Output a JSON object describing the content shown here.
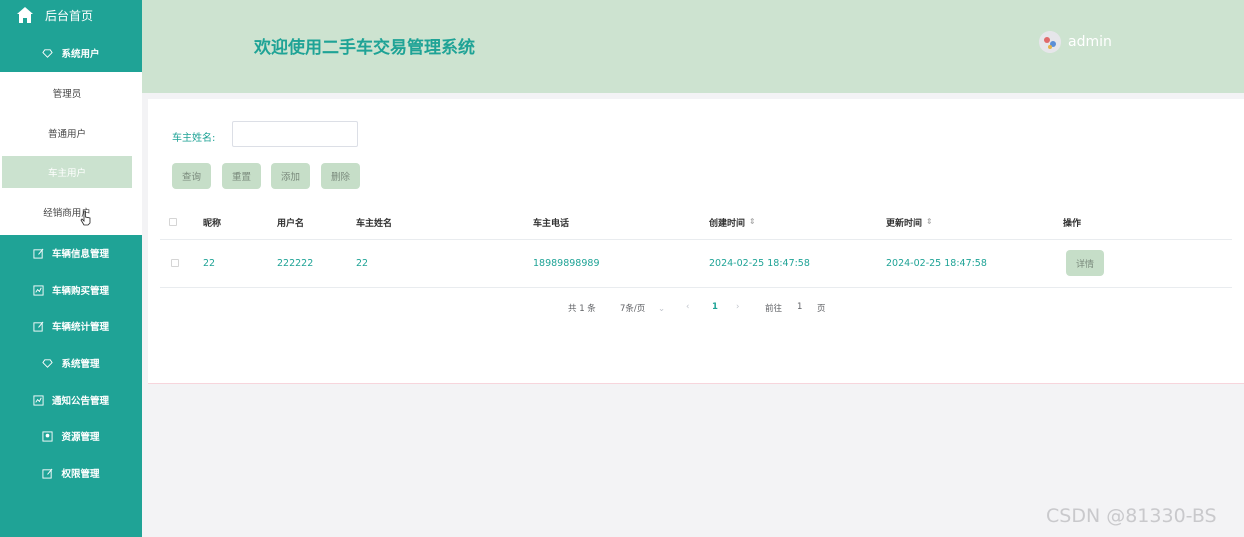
{
  "sidebar": {
    "home_label": "后台首页",
    "group_label": "系统用户",
    "sub_items": [
      "管理员",
      "普通用户",
      "车主用户",
      "经销商用户"
    ],
    "menu_items": [
      {
        "label": "车辆信息管理",
        "icon": "edit-icon"
      },
      {
        "label": "车辆购买管理",
        "icon": "chart-icon"
      },
      {
        "label": "车辆统计管理",
        "icon": "edit-icon"
      },
      {
        "label": "系统管理",
        "icon": "diamond-icon"
      },
      {
        "label": "通知公告管理",
        "icon": "chart-icon"
      },
      {
        "label": "资源管理",
        "icon": "user-card-icon"
      },
      {
        "label": "权限管理",
        "icon": "edit-icon"
      }
    ]
  },
  "header": {
    "title": "欢迎使用二手车交易管理系统",
    "username": "admin"
  },
  "search": {
    "label": "车主姓名:",
    "value": ""
  },
  "buttons": {
    "query": "查询",
    "reset": "重置",
    "add": "添加",
    "delete": "删除"
  },
  "table": {
    "columns": [
      "昵称",
      "用户名",
      "车主姓名",
      "车主电话",
      "创建时间",
      "更新时间",
      "操作"
    ],
    "rows": [
      {
        "nickname": "22",
        "username": "222222",
        "owner_name": "22",
        "phone": "18989898989",
        "created": "2024-02-25 18:47:58",
        "updated": "2024-02-25 18:47:58",
        "action": "详情"
      }
    ]
  },
  "pagination": {
    "total": "共 1 条",
    "page_size": "7条/页",
    "current": "1",
    "goto_prefix": "前往",
    "goto_value": "1",
    "goto_suffix": "页"
  },
  "watermark": "CSDN @81330-BS",
  "colors": {
    "primary": "#1fa396",
    "header_bg": "#cde3d0",
    "button_bg": "#c6dec8"
  }
}
